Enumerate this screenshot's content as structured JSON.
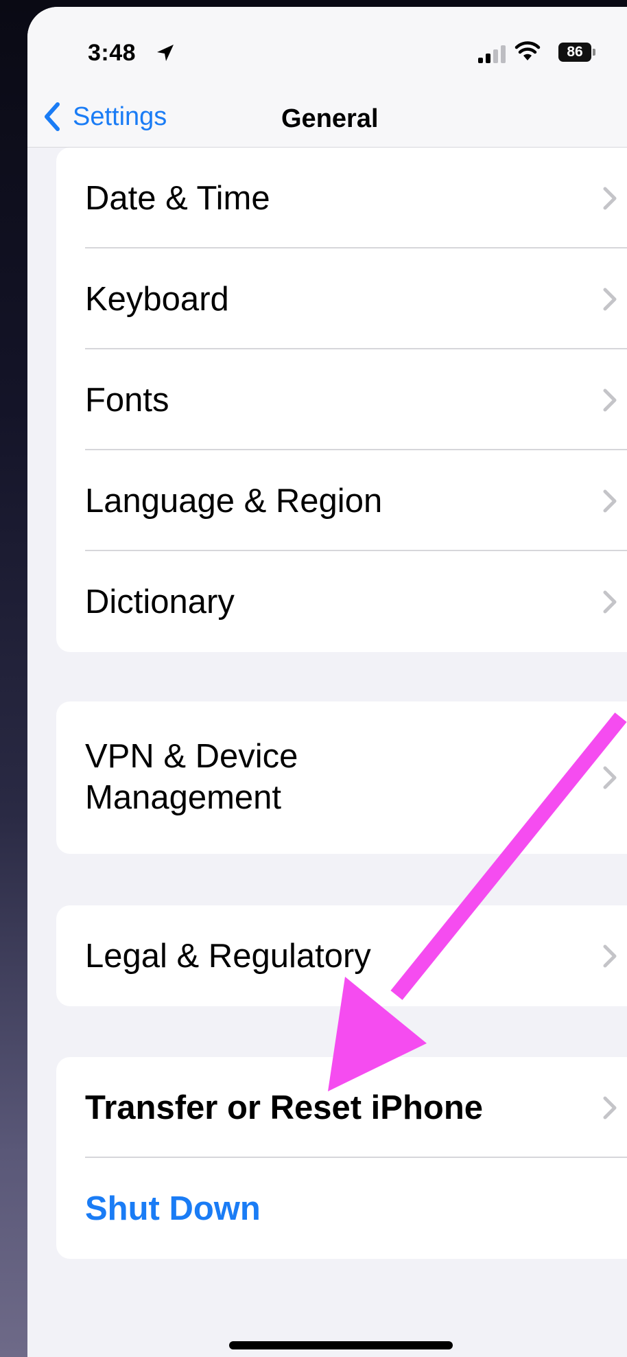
{
  "status_bar": {
    "time": "3:48",
    "battery": "86"
  },
  "nav": {
    "back_label": "Settings",
    "title": "General"
  },
  "groups": [
    {
      "rows": [
        {
          "label": "Date & Time"
        },
        {
          "label": "Keyboard"
        },
        {
          "label": "Fonts"
        },
        {
          "label": "Language & Region"
        },
        {
          "label": "Dictionary"
        }
      ]
    },
    {
      "rows": [
        {
          "label_line1": "VPN & Device",
          "label_line2": "Management"
        }
      ]
    },
    {
      "rows": [
        {
          "label": "Legal & Regulatory"
        }
      ]
    },
    {
      "rows": [
        {
          "label": "Transfer or Reset iPhone"
        },
        {
          "label": "Shut Down"
        }
      ]
    }
  ],
  "colors": {
    "accent": "#1a7cf5",
    "annotation_arrow": "#f54cf0",
    "background": "#f2f2f7"
  },
  "icons": [
    "location-arrow-icon",
    "cellular-signal-icon",
    "wifi-icon",
    "battery-icon",
    "chevron-left-icon",
    "chevron-right-icon"
  ]
}
